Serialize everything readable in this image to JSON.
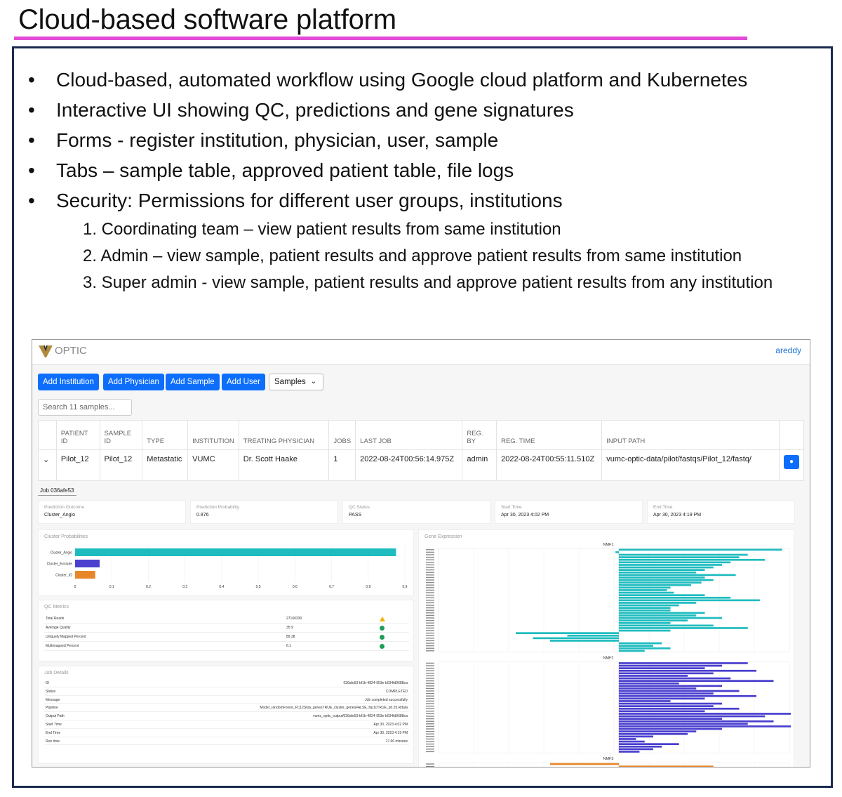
{
  "slide": {
    "title": "Cloud-based software platform",
    "bullets": [
      "Cloud-based, automated workflow using Google cloud platform and Kubernetes",
      "Interactive UI showing QC, predictions and gene signatures",
      "Forms - register institution, physician, user, sample",
      "Tabs – sample table, approved patient table, file logs",
      "Security: Permissions for different user groups, institutions"
    ],
    "sub_items": [
      "1. Coordinating team – view patient results from same institution",
      "2. Admin – view sample, patient results and approve patient results from same institution",
      "3. Super admin - view sample, patient results and approve patient results from any institution"
    ]
  },
  "app": {
    "name": "OPTIC",
    "user": "areddy",
    "buttons": [
      "Add Institution",
      "Add Physician",
      "Add Sample",
      "Add User"
    ],
    "view_select": "Samples",
    "search_placeholder": "Search 11 samples...",
    "table": {
      "headers": [
        "",
        "PATIENT ID",
        "SAMPLE ID",
        "TYPE",
        "INSTITUTION",
        "TREATING PHYSICIAN",
        "JOBS",
        "LAST JOB",
        "REG. BY",
        "REG. TIME",
        "INPUT PATH",
        ""
      ],
      "row": {
        "patient_id": "Pilot_12",
        "sample_id": "Pilot_12",
        "type": "Metastatic",
        "institution": "VUMC",
        "physician": "Dr. Scott Haake",
        "jobs": "1",
        "last_job": "2022-08-24T00:56:14.975Z",
        "reg_by": "admin",
        "reg_time": "2022-08-24T00:55:11.510Z",
        "input_path": "vumc-optic-data/pilot/fastqs/Pilot_12/fastq/"
      }
    },
    "job_tab": "Job 036afe53",
    "summary": [
      {
        "label": "Prediction Outcome",
        "value": "Cluster_Angio"
      },
      {
        "label": "Prediction Probability",
        "value": "0.876"
      },
      {
        "label": "QC Status",
        "value": "PASS"
      },
      {
        "label": "Start Time",
        "value": "Apr 30, 2023 4:02 PM"
      },
      {
        "label": "End Time",
        "value": "Apr 30, 2023 4:19 PM"
      }
    ],
    "cluster_panel_title": "Cluster Probabilities",
    "qc": {
      "title": "QC Metrics",
      "rows": [
        {
          "label": "Total Reads",
          "value": "27160330",
          "status": "warning"
        },
        {
          "label": "Average Quality",
          "value": "35.9",
          "status": "ok"
        },
        {
          "label": "Uniquely Mapped Percent",
          "value": "89.38",
          "status": "ok"
        },
        {
          "label": "Multimapped Percent",
          "value": "6.1",
          "status": "ok"
        }
      ]
    },
    "job_details": {
      "title": "Job Details",
      "rows": [
        {
          "label": "ID",
          "value": "036afe53-bf1b-4824-953e-b034fd9688ea"
        },
        {
          "label": "Status",
          "value": "COMPLETED"
        },
        {
          "label": "Message",
          "value": "Job completed successfully"
        },
        {
          "label": "Pipeline",
          "value": "Model_randomForest_FC12Stop_genesTRUE_cluster_genesFALSE_fsp1cTRUE_p0.25.Rdata"
        },
        {
          "label": "Output Path",
          "value": "vumc_optic_output/036afe53-bf1b-4824-953e-b034fd9688ea"
        },
        {
          "label": "Start Time",
          "value": "Apr 30, 2023 4:02 PM"
        },
        {
          "label": "End Time",
          "value": "Apr 30, 2023 4:19 PM"
        },
        {
          "label": "Run time",
          "value": "17.66 minutes"
        }
      ]
    },
    "gene_panel_title": "Gene Expression"
  },
  "chart_data": [
    {
      "type": "bar",
      "orientation": "horizontal",
      "title": "Cluster Probabilities",
      "categories": [
        "Cluster_Angio",
        "Cluster_Exclude",
        "Cluster_IO"
      ],
      "values": [
        0.876,
        0.067,
        0.055
      ],
      "xlim": [
        0,
        0.9
      ],
      "xticks": [
        0,
        0.1,
        0.2,
        0.3,
        0.4,
        0.5,
        0.6,
        0.7,
        0.8,
        0.9
      ],
      "colors": [
        "#1fbcbf",
        "#4a3fcf",
        "#e8872a"
      ]
    },
    {
      "type": "bar",
      "orientation": "horizontal",
      "title": "Gene Expression",
      "series": [
        {
          "name": "NMF1",
          "color": "#1fbcbf",
          "values": [
            0.95,
            -0.02,
            0.75,
            0.7,
            0.85,
            0.65,
            0.6,
            0.55,
            0.5,
            0.45,
            0.68,
            0.5,
            0.55,
            0.48,
            0.42,
            0.3,
            0.28,
            0.32,
            0.5,
            0.65,
            0.82,
            0.45,
            0.35,
            0.3,
            0.3,
            0.5,
            0.45,
            0.6,
            0.4,
            0.3,
            0.55,
            0.75,
            0.3,
            -0.6,
            -0.3,
            -0.5,
            -0.4,
            0.25,
            0.2,
            0.3,
            0.15
          ]
        },
        {
          "name": "NMF2",
          "color": "#4a3fcf",
          "values": [
            0.75,
            0.6,
            0.5,
            0.8,
            0.55,
            0.4,
            0.65,
            0.9,
            0.35,
            0.6,
            0.45,
            0.7,
            0.55,
            0.8,
            0.5,
            0.3,
            0.6,
            0.55,
            0.7,
            0.5,
            1.0,
            0.85,
            0.6,
            0.9,
            0.75,
            1.0,
            0.6,
            0.45,
            0.4,
            0.2,
            0.1,
            0.15,
            0.35,
            0.25,
            0.2,
            0.12
          ]
        },
        {
          "name": "NMF3",
          "color": "#e8872a",
          "values": [
            -0.4,
            0.55,
            -0.2,
            0.15,
            0.35,
            0.4,
            0.6
          ]
        }
      ]
    }
  ]
}
